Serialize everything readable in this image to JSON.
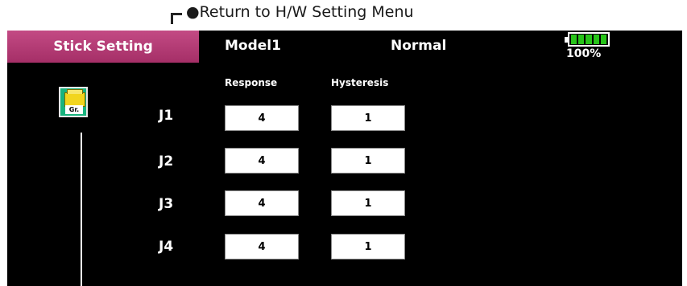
{
  "annotation": "●Return to H/W Setting Menu",
  "header": {
    "title": "Stick Setting",
    "model": "Model1",
    "mode": "Normal",
    "battery_percent": "100%",
    "battery_level": 1.0,
    "battery_color": "#27c419"
  },
  "columns": {
    "response": "Response",
    "hysteresis": "Hysteresis"
  },
  "group_button": {
    "label": "Gr.",
    "icon": "group-folder-icon"
  },
  "rows": [
    {
      "label": "J1",
      "response": "4",
      "hysteresis": "1"
    },
    {
      "label": "J2",
      "response": "4",
      "hysteresis": "1"
    },
    {
      "label": "J3",
      "response": "4",
      "hysteresis": "1"
    },
    {
      "label": "J4",
      "response": "4",
      "hysteresis": "1"
    }
  ],
  "colors": {
    "title_tab": "#b83d77",
    "screen_bg": "#000000",
    "accent": "#19b37e"
  }
}
